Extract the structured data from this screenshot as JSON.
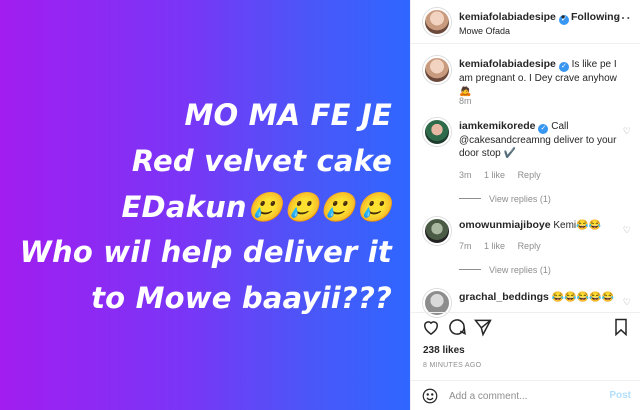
{
  "image": {
    "lines": [
      "MO MA FE JE",
      "Red velvet cake",
      "EDakun🥲🥲🥲🥲",
      "Who wil help deliver it",
      "to Mowe baayii???"
    ],
    "gradient": [
      "#a21df0",
      "#2f67ff"
    ]
  },
  "header": {
    "username": "kemiafolabiadesipe",
    "separator": "•",
    "follow_label": "Following",
    "location": "Mowe Ofada",
    "more_icon": "more-horizontal-icon"
  },
  "caption": {
    "username": "kemiafolabiadesipe",
    "text": "Is like pe I am pregnant o. I Dey crave anyhow🙇",
    "time": "8m"
  },
  "comments": [
    {
      "username": "iamkemikorede",
      "text": "Call @cakesandcreamng deliver to your door stop ✔️",
      "time": "3m",
      "likes": "1 like",
      "reply": "Reply",
      "view_replies": "View replies (1)"
    },
    {
      "username": "omowunmiajiboye",
      "text": "Kemi😂😂",
      "time": "7m",
      "likes": "1 like",
      "reply": "Reply",
      "view_replies": "View replies (1)"
    },
    {
      "username": "grachal_beddings",
      "text": "😂😂😂😂😂"
    }
  ],
  "stats": {
    "likes": "238 likes",
    "ago": "8 MINUTES AGO"
  },
  "composer": {
    "placeholder": "Add a comment...",
    "post_label": "Post"
  },
  "colors": {
    "verified": "#3897f0",
    "post_disabled": "#b2dffc",
    "muted": "#8e8e8e"
  }
}
